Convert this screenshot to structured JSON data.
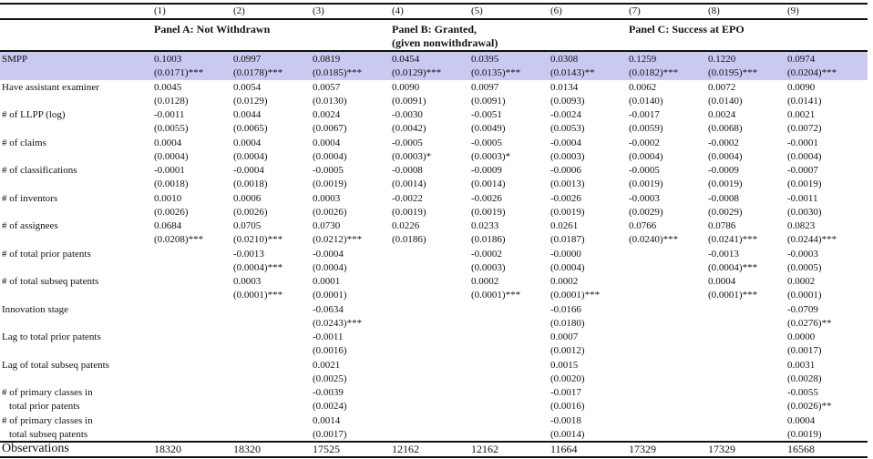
{
  "table": {
    "column_numbers": [
      "(1)",
      "(2)",
      "(3)",
      "(4)",
      "(5)",
      "(6)",
      "(7)",
      "(8)",
      "(9)"
    ],
    "panels": [
      {
        "label": "Panel A: Not Withdrawn",
        "line2": ""
      },
      {
        "label": "Panel B: Granted,",
        "line2": "(given nonwithdrawal)"
      },
      {
        "label": "Panel C: Success at EPO",
        "line2": ""
      }
    ],
    "highlight_color": "#c9c9f2",
    "rows": [
      {
        "label": "SMPP",
        "label2": "",
        "coef": [
          "0.1003",
          "0.0997",
          "0.0819",
          "0.0454",
          "0.0395",
          "0.0308",
          "0.1259",
          "0.1220",
          "0.0974"
        ],
        "se": [
          "(0.0171)***",
          "(0.0178)***",
          "(0.0185)***",
          "(0.0129)***",
          "(0.0135)***",
          "(0.0143)**",
          "(0.0182)***",
          "(0.0195)***",
          "(0.0204)***"
        ]
      },
      {
        "label": "Have assistant examiner",
        "label2": "",
        "coef": [
          "0.0045",
          "0.0054",
          "0.0057",
          "0.0090",
          "0.0097",
          "0.0134",
          "0.0062",
          "0.0072",
          "0.0090"
        ],
        "se": [
          "(0.0128)",
          "(0.0129)",
          "(0.0130)",
          "(0.0091)",
          "(0.0091)",
          "(0.0093)",
          "(0.0140)",
          "(0.0140)",
          "(0.0141)"
        ]
      },
      {
        "label": "# of LLPP (log)",
        "label2": "",
        "coef": [
          "-0.0011",
          "0.0044",
          "0.0024",
          "-0.0030",
          "-0.0051",
          "-0.0024",
          "-0.0017",
          "0.0024",
          "0.0021"
        ],
        "se": [
          "(0.0055)",
          "(0.0065)",
          "(0.0067)",
          "(0.0042)",
          "(0.0049)",
          "(0.0053)",
          "(0.0059)",
          "(0.0068)",
          "(0.0072)"
        ]
      },
      {
        "label": "# of claims",
        "label2": "",
        "coef": [
          "0.0004",
          "0.0004",
          "0.0004",
          "-0.0005",
          "-0.0005",
          "-0.0004",
          "-0.0002",
          "-0.0002",
          "-0.0001"
        ],
        "se": [
          "(0.0004)",
          "(0.0004)",
          "(0.0004)",
          "(0.0003)*",
          "(0.0003)*",
          "(0.0003)",
          "(0.0004)",
          "(0.0004)",
          "(0.0004)"
        ]
      },
      {
        "label": "# of classifications",
        "label2": "",
        "coef": [
          "-0.0001",
          "-0.0004",
          "-0.0005",
          "-0.0008",
          "-0.0009",
          "-0.0006",
          "-0.0005",
          "-0.0009",
          "-0.0007"
        ],
        "se": [
          "(0.0018)",
          "(0.0018)",
          "(0.0019)",
          "(0.0014)",
          "(0.0014)",
          "(0.0013)",
          "(0.0019)",
          "(0.0019)",
          "(0.0019)"
        ]
      },
      {
        "label": "# of inventors",
        "label2": "",
        "coef": [
          "0.0010",
          "0.0006",
          "0.0003",
          "-0.0022",
          "-0.0026",
          "-0.0026",
          "-0.0003",
          "-0.0008",
          "-0.0011"
        ],
        "se": [
          "(0.0026)",
          "(0.0026)",
          "(0.0026)",
          "(0.0019)",
          "(0.0019)",
          "(0.0019)",
          "(0.0029)",
          "(0.0029)",
          "(0.0030)"
        ]
      },
      {
        "label": "# of assignees",
        "label2": "",
        "coef": [
          "0.0684",
          "0.0705",
          "0.0730",
          "0.0226",
          "0.0233",
          "0.0261",
          "0.0766",
          "0.0786",
          "0.0823"
        ],
        "se": [
          "(0.0208)***",
          "(0.0210)***",
          "(0.0212)***",
          "(0.0186)",
          "(0.0186)",
          "(0.0187)",
          "(0.0240)***",
          "(0.0241)***",
          "(0.0244)***"
        ]
      },
      {
        "label": "# of total prior patents",
        "label2": "",
        "coef": [
          "",
          "-0.0013",
          "-0.0004",
          "",
          "-0.0002",
          "-0.0000",
          "",
          "-0.0013",
          "-0.0003"
        ],
        "se": [
          "",
          "(0.0004)***",
          "(0.0004)",
          "",
          "(0.0003)",
          "(0.0004)",
          "",
          "(0.0004)***",
          "(0.0005)"
        ]
      },
      {
        "label": "# of total subseq patents",
        "label2": "",
        "coef": [
          "",
          "0.0003",
          "0.0001",
          "",
          "0.0002",
          "0.0002",
          "",
          "0.0004",
          "0.0002"
        ],
        "se": [
          "",
          "(0.0001)***",
          "(0.0001)",
          "",
          "(0.0001)***",
          "(0.0001)***",
          "",
          "(0.0001)***",
          "(0.0001)"
        ]
      },
      {
        "label": "Innovation stage",
        "label2": "",
        "coef": [
          "",
          "",
          "-0.0634",
          "",
          "",
          "-0.0166",
          "",
          "",
          "-0.0709"
        ],
        "se": [
          "",
          "",
          "(0.0243)***",
          "",
          "",
          "(0.0180)",
          "",
          "",
          "(0.0276)**"
        ]
      },
      {
        "label": "Lag to total prior patents",
        "label2": "",
        "coef": [
          "",
          "",
          "-0.0011",
          "",
          "",
          "0.0007",
          "",
          "",
          "0.0000"
        ],
        "se": [
          "",
          "",
          "(0.0016)",
          "",
          "",
          "(0.0012)",
          "",
          "",
          "(0.0017)"
        ]
      },
      {
        "label": "Lag of total subseq patents",
        "label2": "",
        "coef": [
          "",
          "",
          "0.0021",
          "",
          "",
          "0.0015",
          "",
          "",
          "0.0031"
        ],
        "se": [
          "",
          "",
          "(0.0025)",
          "",
          "",
          "(0.0020)",
          "",
          "",
          "(0.0028)"
        ]
      },
      {
        "label": "# of primary classes in",
        "label2": "total prior patents",
        "coef": [
          "",
          "",
          "-0.0039",
          "",
          "",
          "-0.0017",
          "",
          "",
          "-0.0055"
        ],
        "se": [
          "",
          "",
          "(0.0024)",
          "",
          "",
          "(0.0016)",
          "",
          "",
          "(0.0026)**"
        ]
      },
      {
        "label": "# of primary classes in",
        "label2": "total subseq patents",
        "coef": [
          "",
          "",
          "0.0014",
          "",
          "",
          "-0.0018",
          "",
          "",
          "0.0004"
        ],
        "se": [
          "",
          "",
          "(0.0017)",
          "",
          "",
          "(0.0014)",
          "",
          "",
          "(0.0019)"
        ]
      }
    ],
    "observations": {
      "label": "Observations",
      "values": [
        "18320",
        "18320",
        "17525",
        "12162",
        "12162",
        "11664",
        "17329",
        "17329",
        "16568"
      ]
    }
  }
}
